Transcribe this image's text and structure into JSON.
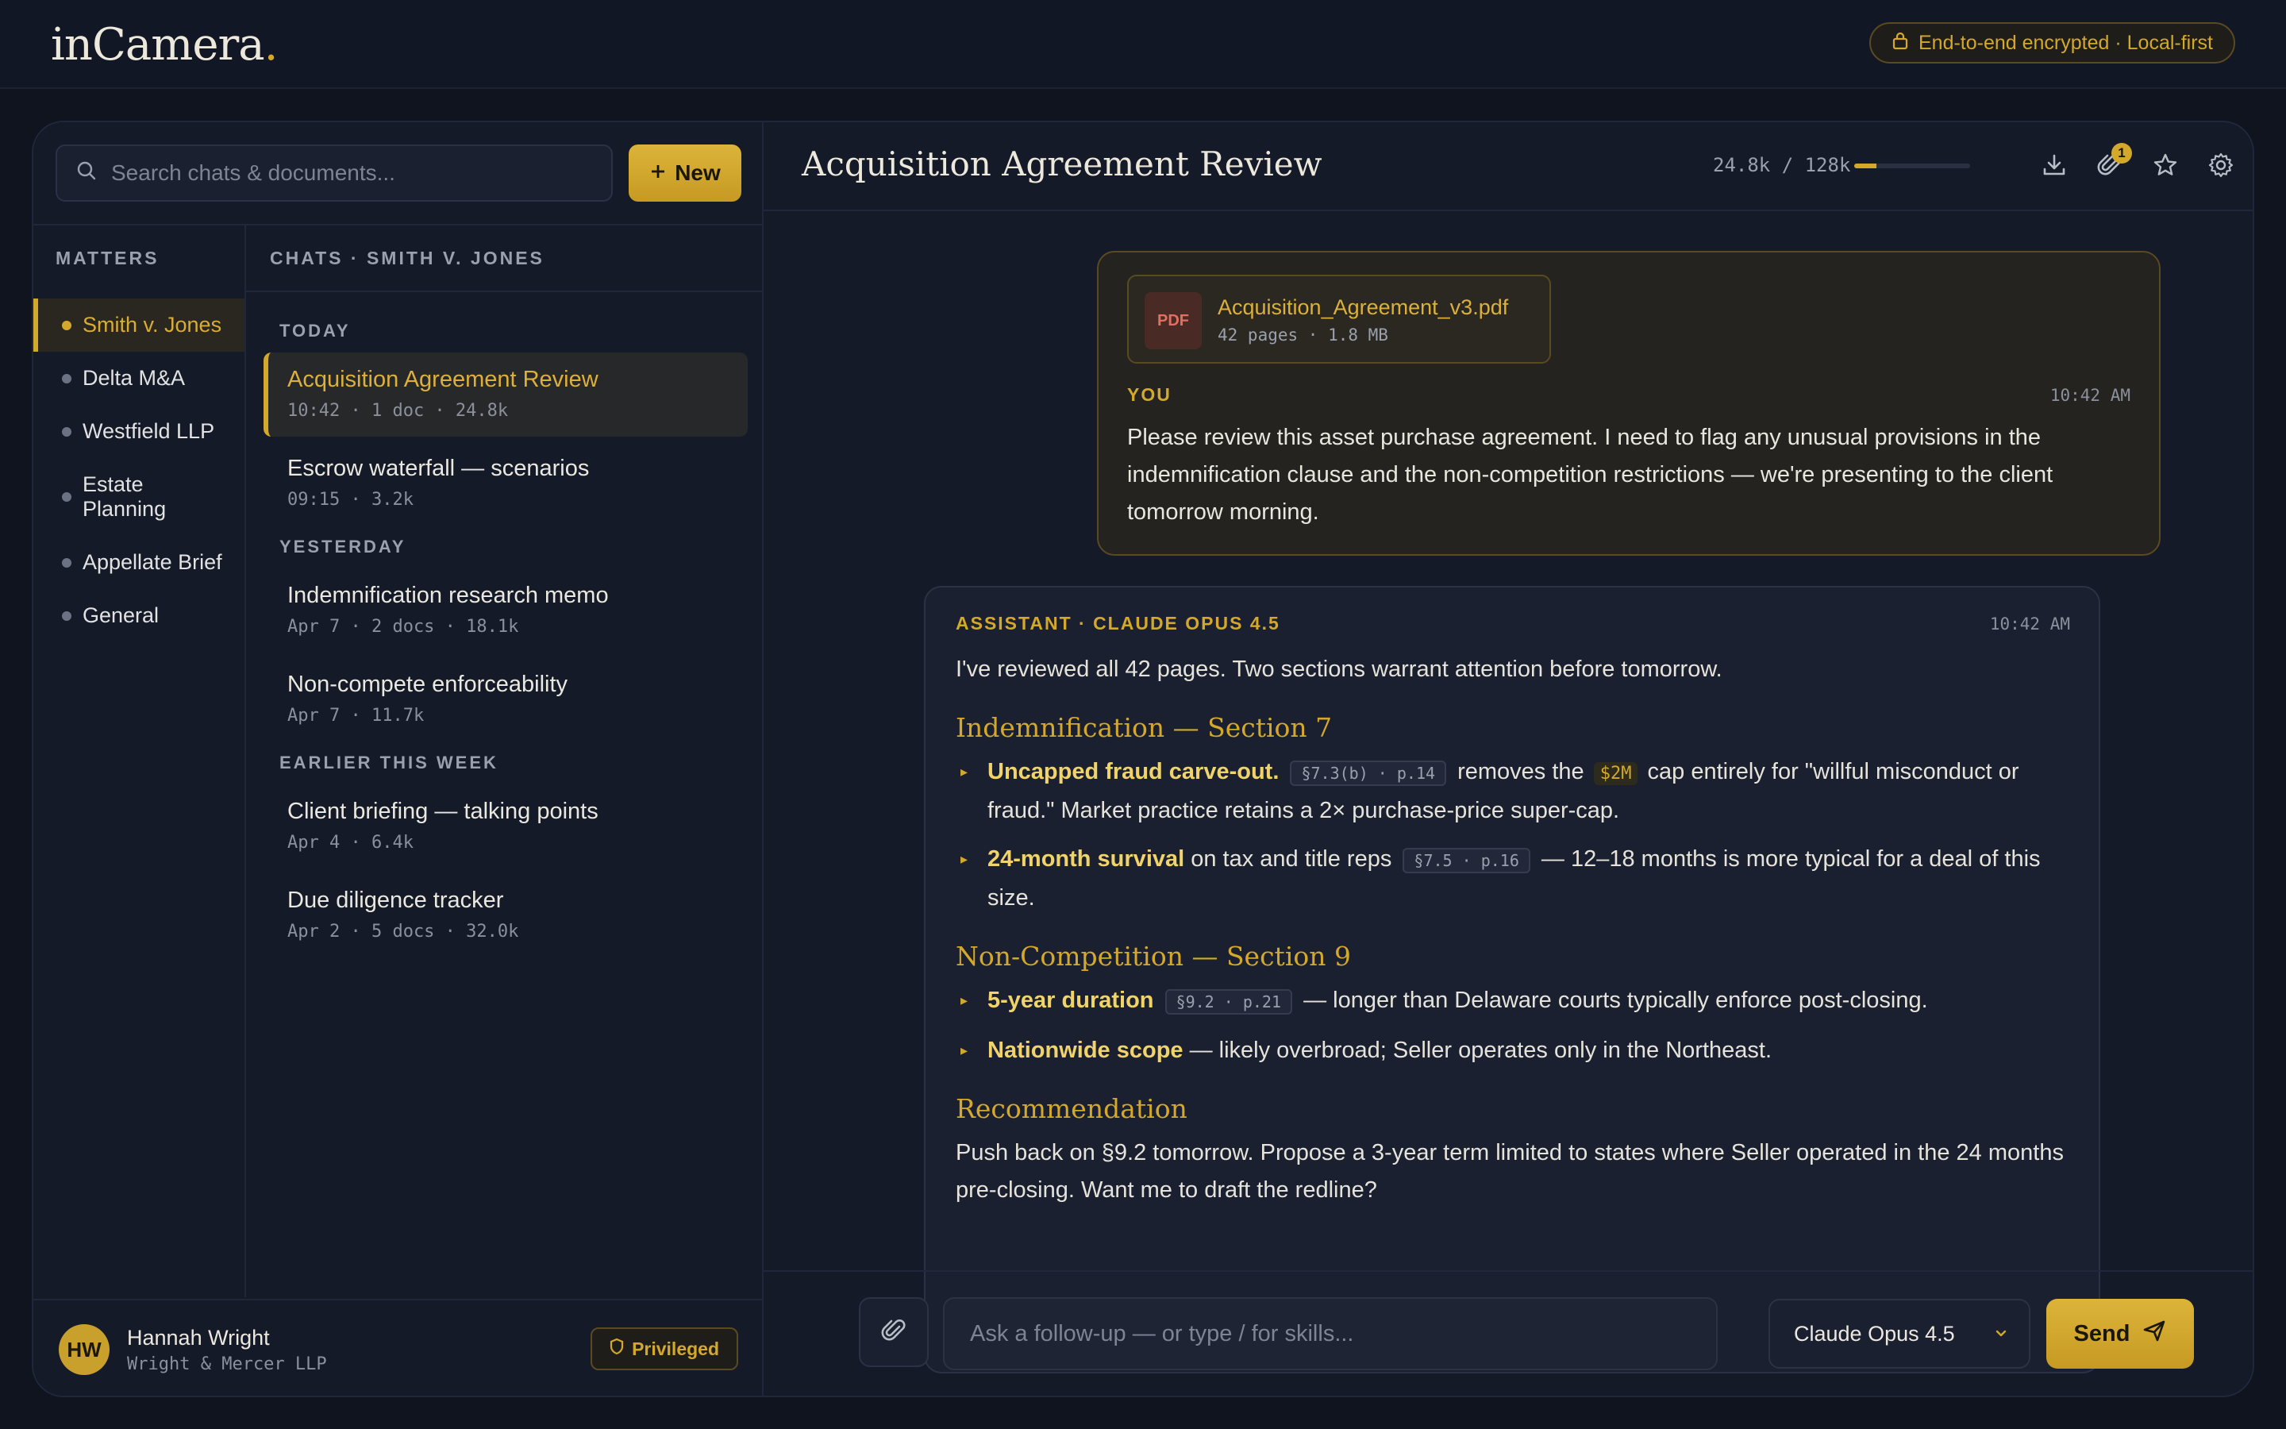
{
  "app": {
    "logo_text": "inCamera",
    "logo_dot": ".",
    "security_badge": "End-to-end encrypted · Local-first"
  },
  "sidebar": {
    "search_placeholder": "Search chats & documents...",
    "new_label": "New",
    "matters_label": "MATTERS",
    "matters": [
      {
        "label": "Smith v. Jones",
        "active": true
      },
      {
        "label": "Delta M&A",
        "active": false
      },
      {
        "label": "Westfield LLP",
        "active": false
      },
      {
        "label": "Estate Planning",
        "active": false
      },
      {
        "label": "Appellate Brief",
        "active": false
      },
      {
        "label": "General",
        "active": false
      }
    ],
    "chats_label": "CHATS · SMITH V. JONES",
    "groups": [
      {
        "label": "TODAY",
        "chats": [
          {
            "title": "Acquisition Agreement Review",
            "meta": "10:42 · 1 doc · 24.8k",
            "active": true
          },
          {
            "title": "Escrow waterfall — scenarios",
            "meta": "09:15 · 3.2k",
            "active": false
          }
        ]
      },
      {
        "label": "YESTERDAY",
        "chats": [
          {
            "title": "Indemnification research memo",
            "meta": "Apr 7 · 2 docs · 18.1k",
            "active": false
          },
          {
            "title": "Non-compete enforceability",
            "meta": "Apr 7 · 11.7k",
            "active": false
          }
        ]
      },
      {
        "label": "EARLIER THIS WEEK",
        "chats": [
          {
            "title": "Client briefing — talking points",
            "meta": "Apr 4 · 6.4k",
            "active": false
          },
          {
            "title": "Due diligence tracker",
            "meta": "Apr 2 · 5 docs · 32.0k",
            "active": false
          }
        ]
      }
    ],
    "user": {
      "initials": "HW",
      "name": "Hannah Wright",
      "firm": "Wright & Mercer LLP",
      "badge": "Privileged"
    }
  },
  "conversation": {
    "title": "Acquisition Agreement Review",
    "context_usage": "24.8k / 128k",
    "context_fraction": 0.19,
    "attachments_count": "1",
    "user_message": {
      "attachment": {
        "type": "PDF",
        "name": "Acquisition_Agreement_v3.pdf",
        "meta": "42 pages · 1.8 MB"
      },
      "sender": "YOU",
      "time": "10:42 AM",
      "text": "Please review this asset purchase agreement. I need to flag any unusual provisions in the indemnification clause and the non-competition restrictions — we're presenting to the client tomorrow morning."
    },
    "assistant_message": {
      "sender": "ASSISTANT · CLAUDE OPUS 4.5",
      "time": "10:42 AM",
      "intro": "I've reviewed all 42 pages. Two sections warrant attention before tomorrow.",
      "sections": [
        {
          "heading": "Indemnification — Section 7",
          "bullets": [
            {
              "lead": "Uncapped fraud carve-out.",
              "cite": "§7.3(b) · p.14",
              "pre": " removes the ",
              "money": "$2M",
              "rest": " cap entirely for \"willful misconduct or fraud.\" Market practice retains a 2× purchase-price super-cap."
            },
            {
              "lead": "24-month survival",
              "pre_cite": " on tax and title reps ",
              "cite": "§7.5 · p.16",
              "rest": " — 12–18 months is more typical for a deal of this size."
            }
          ]
        },
        {
          "heading": "Non-Competition — Section 9",
          "bullets": [
            {
              "lead": "5-year duration",
              "cite": "§9.2 · p.21",
              "rest": " — longer than Delaware courts typically enforce post-closing."
            },
            {
              "lead": "Nationwide scope",
              "rest": " — likely overbroad; Seller operates only in the Northeast."
            }
          ]
        }
      ],
      "recommendation_heading": "Recommendation",
      "recommendation_text": "Push back on §9.2 tomorrow. Propose a 3-year term limited to states where Seller operated in the 24 months pre-closing. Want me to draft the redline?"
    },
    "composer": {
      "placeholder": "Ask a follow-up — or type / for skills...",
      "model": "Claude Opus 4.5",
      "send_label": "Send"
    }
  },
  "colors": {
    "accent": "#d4a82a",
    "background": "#10141f",
    "panel": "#141a28"
  },
  "icons": [
    "lock-icon",
    "search-icon",
    "plus-icon",
    "download-icon",
    "paperclip-icon",
    "star-icon",
    "gear-icon",
    "shield-icon",
    "chevron-down-icon",
    "send-icon"
  ]
}
